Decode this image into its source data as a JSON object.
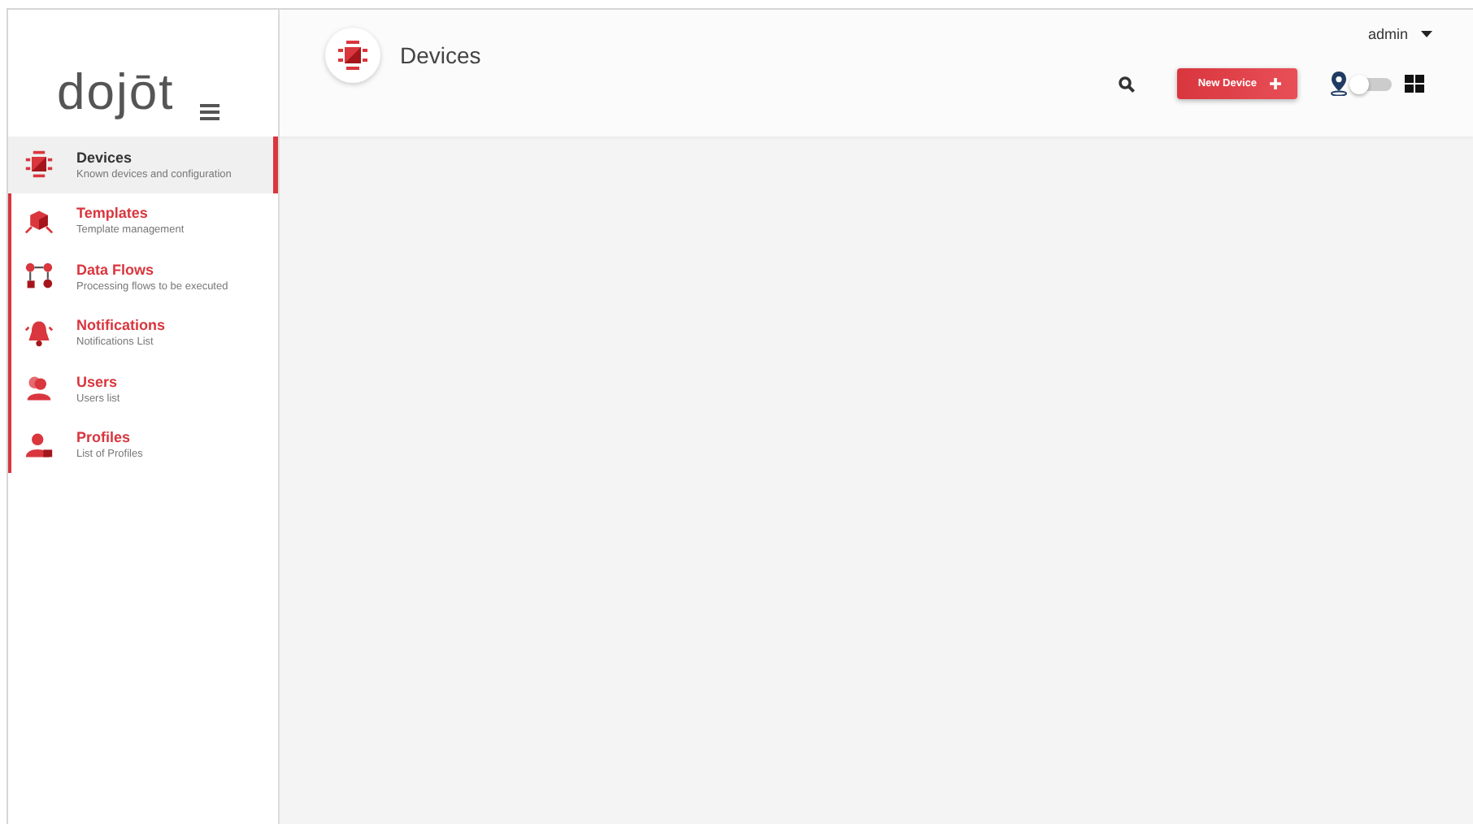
{
  "sidebar": {
    "logo": "dojōt",
    "items": [
      {
        "kind": "devices",
        "label": "Devices",
        "description": "Known devices and configuration",
        "selected": true
      },
      {
        "kind": "templates",
        "label": "Templates",
        "description": "Template management",
        "selected": false
      },
      {
        "kind": "flows",
        "label": "Data Flows",
        "description": "Processing flows to be executed",
        "selected": false
      },
      {
        "kind": "notifications",
        "label": "Notifications",
        "description": "Notifications List",
        "selected": false
      },
      {
        "kind": "users",
        "label": "Users",
        "description": "Users list",
        "selected": false
      },
      {
        "kind": "profiles",
        "label": "Profiles",
        "description": "List of Profiles",
        "selected": false
      }
    ]
  },
  "header": {
    "title": "Devices",
    "user": "admin",
    "new_button": "New Device",
    "map_toggle": {
      "on": false
    }
  }
}
